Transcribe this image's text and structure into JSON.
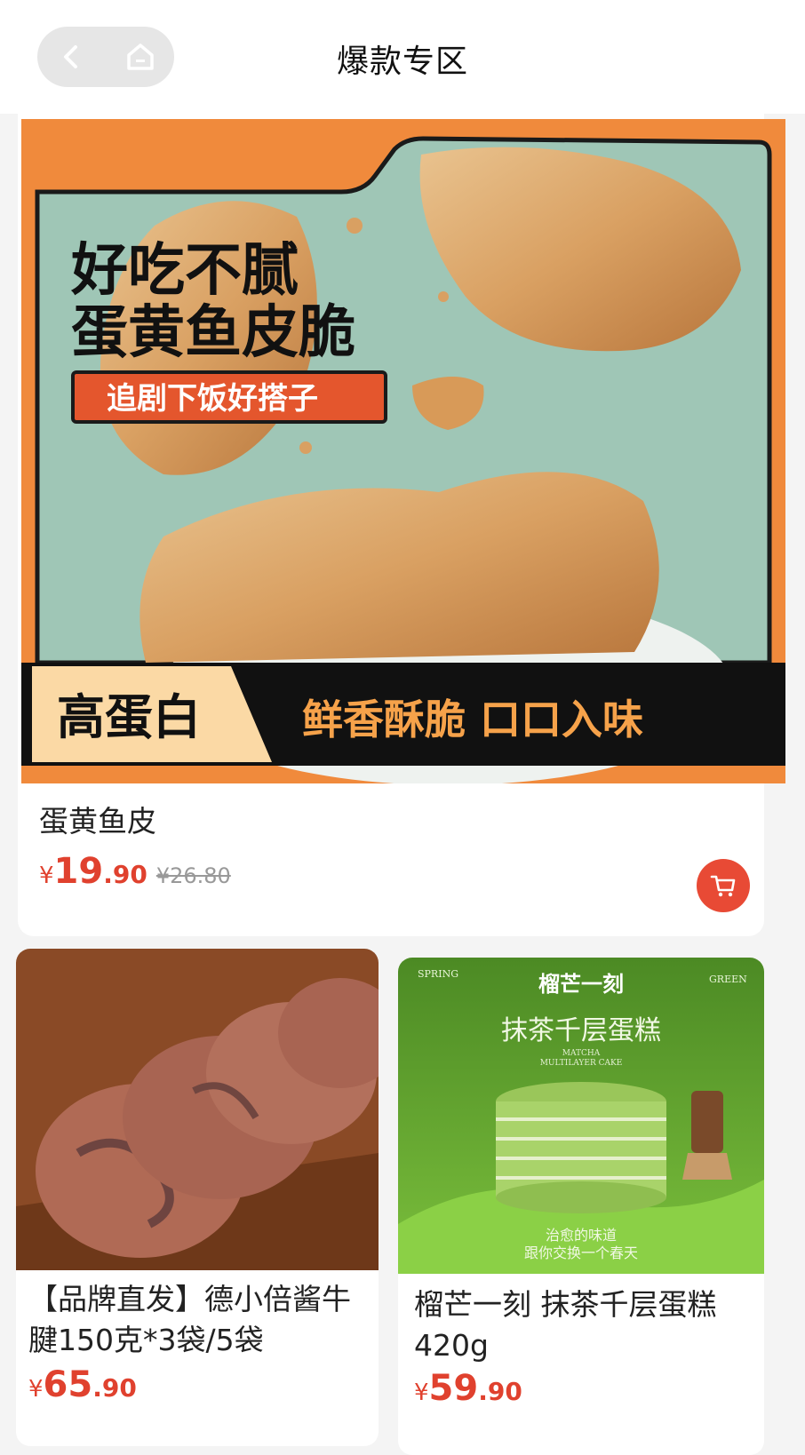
{
  "nav": {
    "title": "爆款专区",
    "back_icon": "chevron-left-icon",
    "home_icon": "home-icon"
  },
  "featured": {
    "banner": {
      "headline_line1": "好吃不腻",
      "headline_line2": "蛋黄鱼皮脆",
      "tag": "追剧下饭好搭子",
      "badge": "高蛋白",
      "slogan": "鲜香酥脆 口口入味"
    },
    "name": "蛋黄鱼皮",
    "price_symbol": "¥",
    "price_int": "19",
    "price_dec": ".90",
    "original_price": "¥26.80"
  },
  "products": [
    {
      "name": "【品牌直发】德小倍酱牛腱150克*3袋/5袋",
      "price_symbol": "¥",
      "price_int": "65",
      "price_dec": ".90"
    },
    {
      "name": "榴芒一刻 抹茶千层蛋糕420g",
      "price_symbol": "¥",
      "price_int": "59",
      "price_dec": ".90",
      "image": {
        "brand": "榴芒一刻",
        "left_tag": "SPRING",
        "right_tag": "GREEN",
        "title": "抹茶千层蛋糕",
        "subtitle_line1": "MATCHA",
        "subtitle_line2": "MULTILAYER CAKE",
        "slogan_line1": "治愈的味道",
        "slogan_line2": "跟你交换一个春天"
      }
    }
  ],
  "colors": {
    "accent": "#e0412e",
    "banner_orange": "#f08a3c",
    "banner_bg": "#9fc6b6",
    "matcha": "#5b9e2a"
  }
}
